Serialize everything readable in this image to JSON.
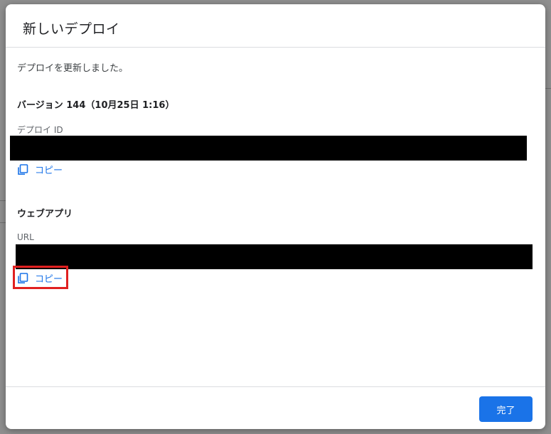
{
  "dialog": {
    "title": "新しいデプロイ",
    "message": "デプロイを更新しました。",
    "version_heading": "バージョン 144（10月25日 1:16）",
    "deploy_id": {
      "label": "デプロイ ID",
      "copy_label": "コピー"
    },
    "web_app": {
      "heading": "ウェブアプリ",
      "url_label": "URL",
      "copy_label": "コピー"
    },
    "done_label": "完了"
  },
  "colors": {
    "accent": "#1a73e8",
    "highlight": "#e02020",
    "redaction": "#000000"
  },
  "icons": {
    "copy": "copy-icon"
  }
}
